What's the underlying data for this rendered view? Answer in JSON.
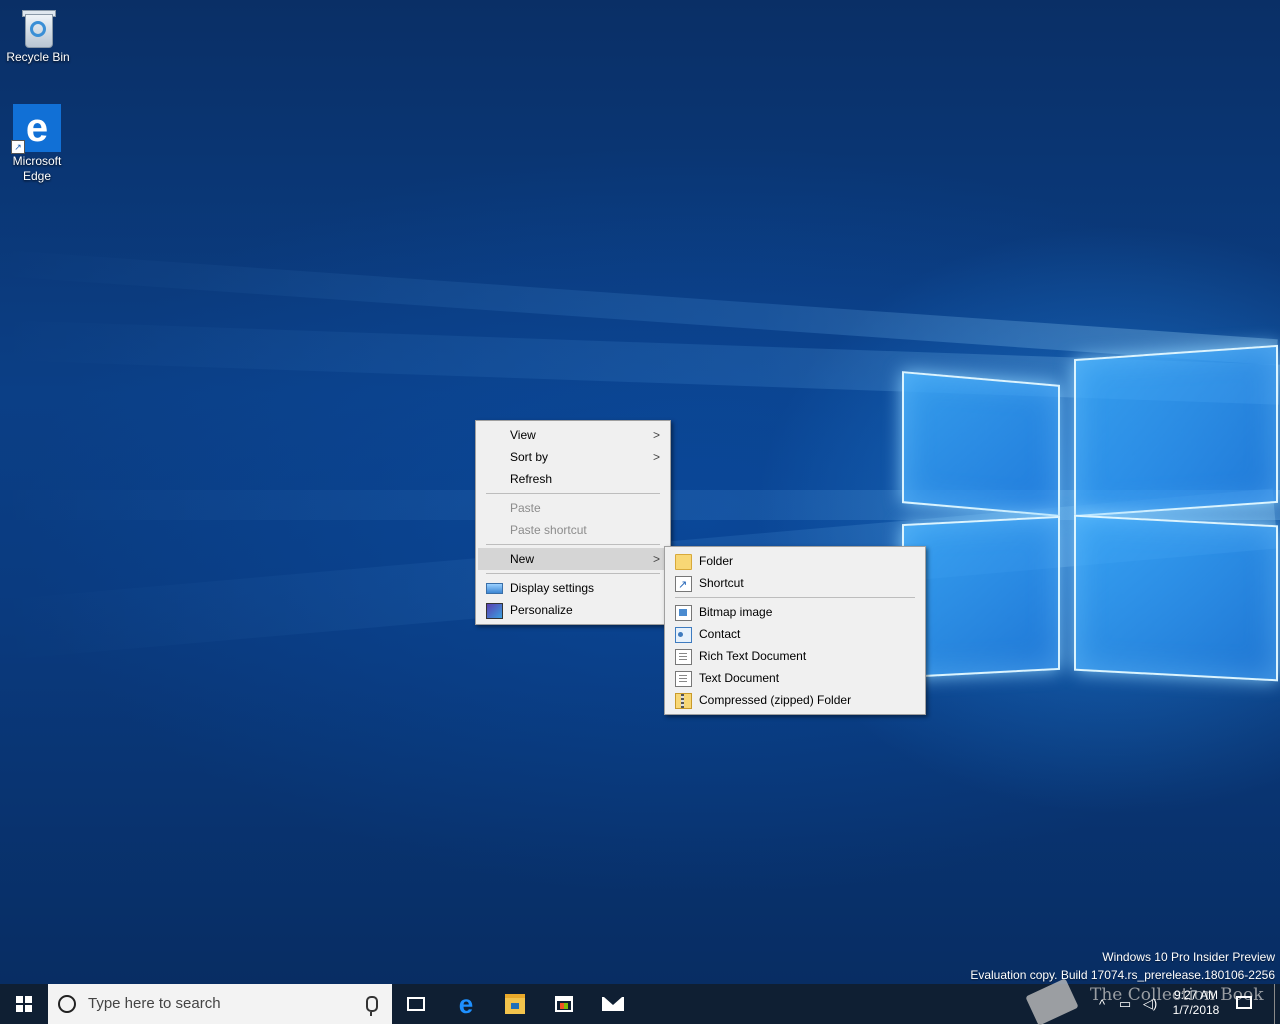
{
  "desktop": {
    "icons": [
      {
        "label": "Recycle Bin",
        "icon": "recycle-bin-icon"
      },
      {
        "label": "Microsoft Edge",
        "label_line1": "Microsoft",
        "label_line2": "Edge",
        "icon": "edge-icon"
      }
    ],
    "watermark": {
      "line1": "Windows 10 Pro Insider Preview",
      "line2": "Evaluation copy. Build 17074.rs_prerelease.180106-2256"
    }
  },
  "context_menu": {
    "items": [
      {
        "label": "View",
        "submenu": true
      },
      {
        "label": "Sort by",
        "submenu": true
      },
      {
        "label": "Refresh"
      },
      {
        "label": "Paste",
        "disabled": true
      },
      {
        "label": "Paste shortcut",
        "disabled": true
      },
      {
        "label": "New",
        "submenu": true,
        "highlighted": true
      },
      {
        "label": "Display settings",
        "icon": "display-icon"
      },
      {
        "label": "Personalize",
        "icon": "personalize-icon"
      }
    ],
    "arrow_glyph": ">"
  },
  "new_submenu": {
    "items": [
      {
        "label": "Folder",
        "icon": "folder-icon"
      },
      {
        "label": "Shortcut",
        "icon": "shortcut-icon"
      },
      {
        "label": "Bitmap image",
        "icon": "bitmap-icon"
      },
      {
        "label": "Contact",
        "icon": "contact-icon"
      },
      {
        "label": "Rich Text Document",
        "icon": "rich-text-icon"
      },
      {
        "label": "Text Document",
        "icon": "text-document-icon"
      },
      {
        "label": "Compressed (zipped) Folder",
        "icon": "zip-folder-icon"
      }
    ]
  },
  "taskbar": {
    "search_placeholder": "Type here to search",
    "pinned": [
      "task-view-icon",
      "edge-icon",
      "file-explorer-icon",
      "store-icon",
      "mail-icon"
    ],
    "clock_time": "9:27 AM",
    "clock_date": "1/7/2018",
    "tray_overlay_text": "The Collection Book"
  },
  "colors": {
    "taskbar": "#0f1f33",
    "menu_bg": "#f0f0f0",
    "menu_highlight": "#d5d5d5"
  }
}
